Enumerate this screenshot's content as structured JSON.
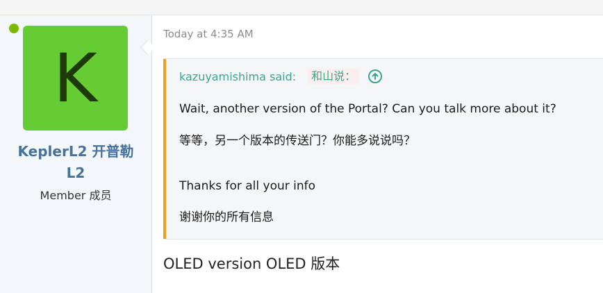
{
  "user": {
    "avatar_letter": "K",
    "username": "KeplerL2 开普勒 L2",
    "title": "Member 成员",
    "online": true
  },
  "post": {
    "timestamp": "Today at 4:35 AM",
    "quote": {
      "author_said": "kazuyamishima said:",
      "author_said_cn": "和山说：",
      "expand_icon": "arrow-up-circle-icon",
      "lines": [
        "Wait, another version of the Portal? Can you talk more about it?",
        "等等，另一个版本的传送门？你能多说说吗？",
        "Thanks for all your info",
        "谢谢你的所有信息"
      ]
    },
    "message": "OLED version OLED 版本"
  },
  "colors": {
    "avatar_bg": "#66cc33",
    "online": "#7fb800",
    "username": "#47729a",
    "quote_bar": "#f0a01e",
    "quote_author": "#3aa58b"
  }
}
